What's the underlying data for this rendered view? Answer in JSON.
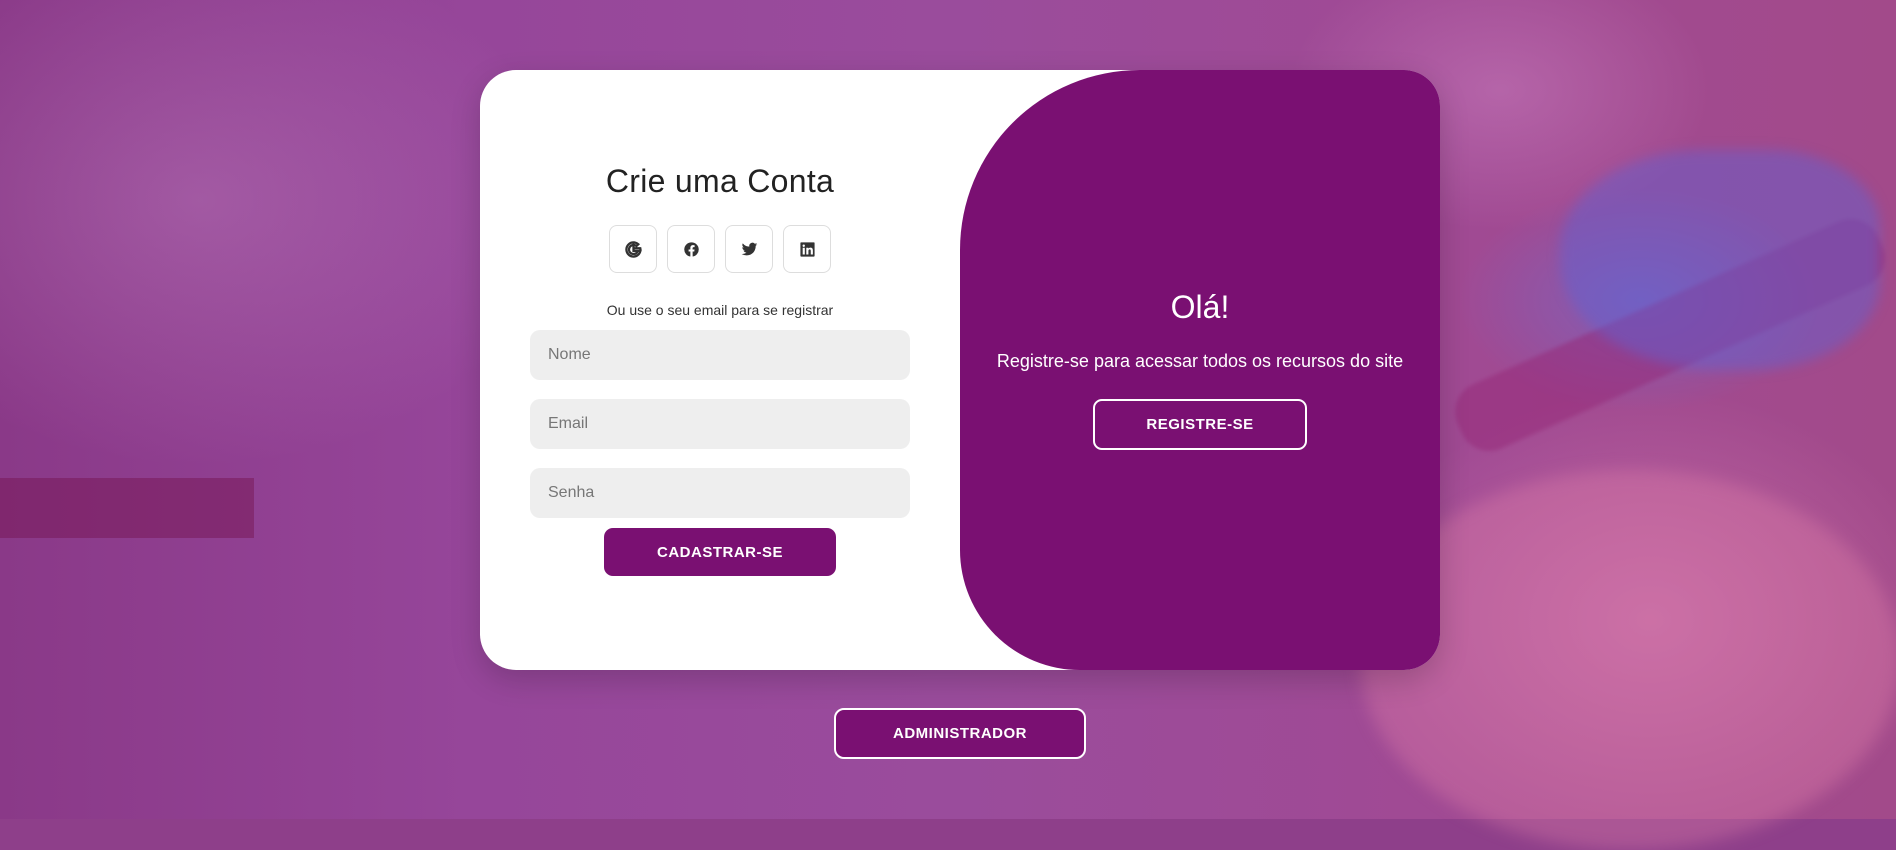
{
  "form": {
    "title": "Crie uma Conta",
    "social_icons": [
      "google-icon",
      "facebook-icon",
      "twitter-icon",
      "linkedin-icon"
    ],
    "hint": "Ou use o seu email para se registrar",
    "name_placeholder": "Nome",
    "email_placeholder": "Email",
    "password_placeholder": "Senha",
    "submit_label": "CADASTRAR-SE"
  },
  "toggle": {
    "title": "Olá!",
    "text": "Registre-se para acessar todos os recursos do site",
    "button_label": "REGISTRE-SE"
  },
  "admin": {
    "button_label": "ADMINISTRADOR"
  },
  "colors": {
    "accent": "#7a1072",
    "background": "#96469a",
    "input_bg": "#eeeeee"
  }
}
